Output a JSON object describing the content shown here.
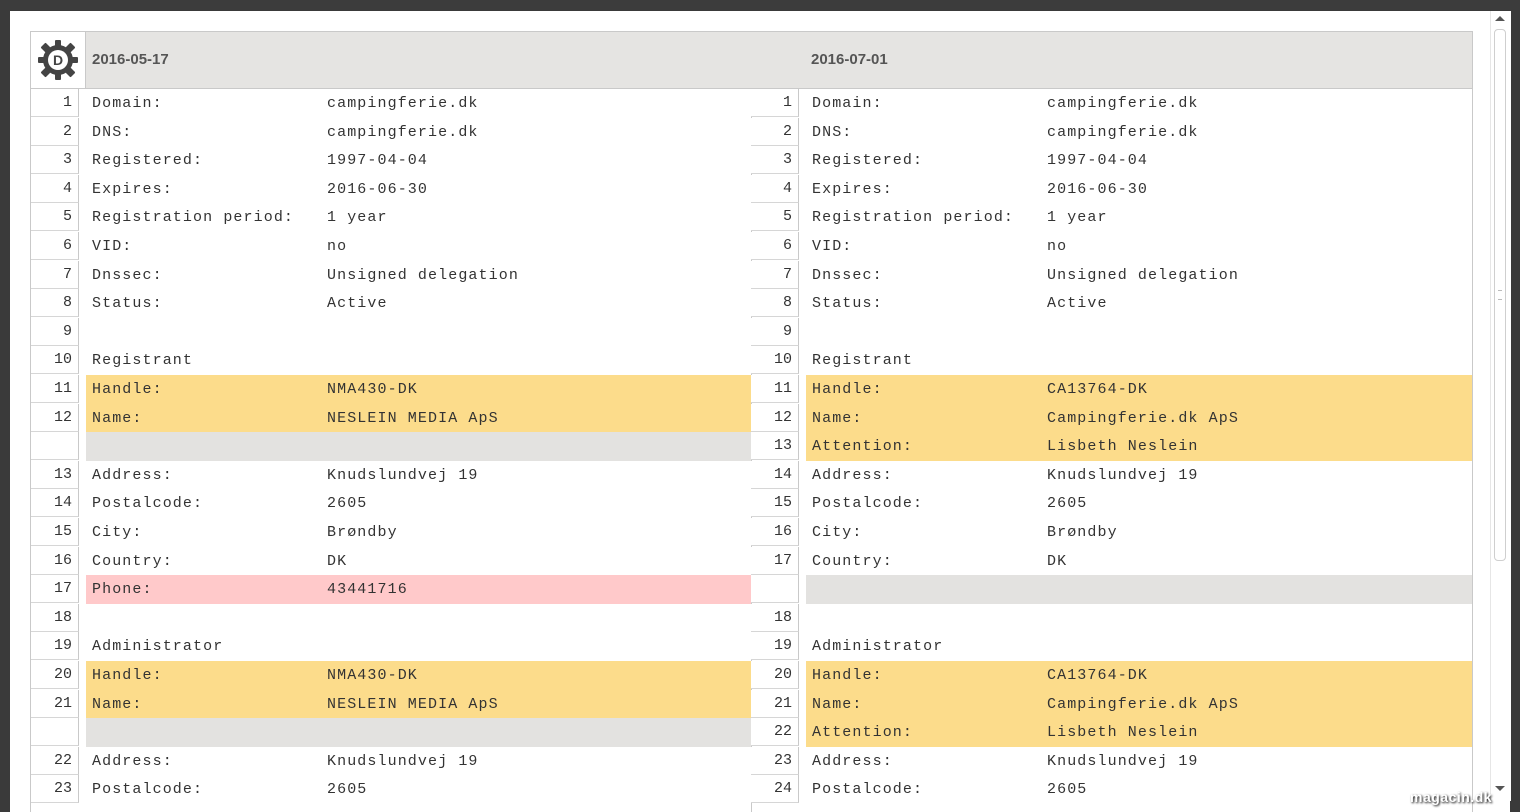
{
  "header": {
    "left_date": "2016-05-17",
    "right_date": "2016-07-01"
  },
  "logo": {
    "letter": "D"
  },
  "left_rows": [
    {
      "n": "1",
      "k": "Domain:",
      "v": "campingferie.dk",
      "t": "normal"
    },
    {
      "n": "2",
      "k": "DNS:",
      "v": "campingferie.dk",
      "t": "normal"
    },
    {
      "n": "3",
      "k": "Registered:",
      "v": "1997-04-04",
      "t": "normal"
    },
    {
      "n": "4",
      "k": "Expires:",
      "v": "2016-06-30",
      "t": "normal"
    },
    {
      "n": "5",
      "k": "Registration period:",
      "v": "1 year",
      "t": "normal"
    },
    {
      "n": "6",
      "k": "VID:",
      "v": "no",
      "t": "normal"
    },
    {
      "n": "7",
      "k": "Dnssec:",
      "v": "Unsigned delegation",
      "t": "normal"
    },
    {
      "n": "8",
      "k": "Status:",
      "v": "Active",
      "t": "normal"
    },
    {
      "n": "9",
      "k": "",
      "v": "",
      "t": "normal"
    },
    {
      "n": "10",
      "k": "Registrant",
      "v": "",
      "t": "normal"
    },
    {
      "n": "11",
      "k": "Handle:",
      "v": "NMA430-DK",
      "t": "changed"
    },
    {
      "n": "12",
      "k": "Name:",
      "v": "NESLEIN MEDIA ApS",
      "t": "changed"
    },
    {
      "n": "",
      "k": "",
      "v": "",
      "t": "gap"
    },
    {
      "n": "13",
      "k": "Address:",
      "v": "Knudslundvej 19",
      "t": "normal"
    },
    {
      "n": "14",
      "k": "Postalcode:",
      "v": "2605",
      "t": "normal"
    },
    {
      "n": "15",
      "k": "City:",
      "v": "Brøndby",
      "t": "normal"
    },
    {
      "n": "16",
      "k": "Country:",
      "v": "DK",
      "t": "normal"
    },
    {
      "n": "17",
      "k": "Phone:",
      "v": "43441716",
      "t": "removed"
    },
    {
      "n": "18",
      "k": "",
      "v": "",
      "t": "normal"
    },
    {
      "n": "19",
      "k": "Administrator",
      "v": "",
      "t": "normal"
    },
    {
      "n": "20",
      "k": "Handle:",
      "v": "NMA430-DK",
      "t": "changed"
    },
    {
      "n": "21",
      "k": "Name:",
      "v": "NESLEIN MEDIA ApS",
      "t": "changed"
    },
    {
      "n": "",
      "k": "",
      "v": "",
      "t": "gap"
    },
    {
      "n": "22",
      "k": "Address:",
      "v": "Knudslundvej 19",
      "t": "normal"
    },
    {
      "n": "23",
      "k": "Postalcode:",
      "v": "2605",
      "t": "normal"
    }
  ],
  "right_rows": [
    {
      "n": "1",
      "k": "Domain:",
      "v": "campingferie.dk",
      "t": "normal"
    },
    {
      "n": "2",
      "k": "DNS:",
      "v": "campingferie.dk",
      "t": "normal"
    },
    {
      "n": "3",
      "k": "Registered:",
      "v": "1997-04-04",
      "t": "normal"
    },
    {
      "n": "4",
      "k": "Expires:",
      "v": "2016-06-30",
      "t": "normal"
    },
    {
      "n": "5",
      "k": "Registration period:",
      "v": "1 year",
      "t": "normal"
    },
    {
      "n": "6",
      "k": "VID:",
      "v": "no",
      "t": "normal"
    },
    {
      "n": "7",
      "k": "Dnssec:",
      "v": "Unsigned delegation",
      "t": "normal"
    },
    {
      "n": "8",
      "k": "Status:",
      "v": "Active",
      "t": "normal"
    },
    {
      "n": "9",
      "k": "",
      "v": "",
      "t": "normal"
    },
    {
      "n": "10",
      "k": "Registrant",
      "v": "",
      "t": "normal"
    },
    {
      "n": "11",
      "k": "Handle:",
      "v": "CA13764-DK",
      "t": "changed"
    },
    {
      "n": "12",
      "k": "Name:",
      "v": "Campingferie.dk ApS",
      "t": "changed"
    },
    {
      "n": "13",
      "k": "Attention:",
      "v": "Lisbeth Neslein",
      "t": "changed"
    },
    {
      "n": "14",
      "k": "Address:",
      "v": "Knudslundvej 19",
      "t": "normal"
    },
    {
      "n": "15",
      "k": "Postalcode:",
      "v": "2605",
      "t": "normal"
    },
    {
      "n": "16",
      "k": "City:",
      "v": "Brøndby",
      "t": "normal"
    },
    {
      "n": "17",
      "k": "Country:",
      "v": "DK",
      "t": "normal"
    },
    {
      "n": "",
      "k": "",
      "v": "",
      "t": "gap"
    },
    {
      "n": "18",
      "k": "",
      "v": "",
      "t": "normal"
    },
    {
      "n": "19",
      "k": "Administrator",
      "v": "",
      "t": "normal"
    },
    {
      "n": "20",
      "k": "Handle:",
      "v": "CA13764-DK",
      "t": "changed"
    },
    {
      "n": "21",
      "k": "Name:",
      "v": "Campingferie.dk ApS",
      "t": "changed"
    },
    {
      "n": "22",
      "k": "Attention:",
      "v": "Lisbeth Neslein",
      "t": "changed"
    },
    {
      "n": "23",
      "k": "Address:",
      "v": "Knudslundvej 19",
      "t": "normal"
    },
    {
      "n": "24",
      "k": "Postalcode:",
      "v": "2605",
      "t": "normal"
    }
  ],
  "colors": {
    "changed": "#fcdc8b",
    "removed": "#ffc9ca",
    "gap": "#e3e2e0",
    "header": "#e5e4e2"
  },
  "watermark": "magacin.dk"
}
